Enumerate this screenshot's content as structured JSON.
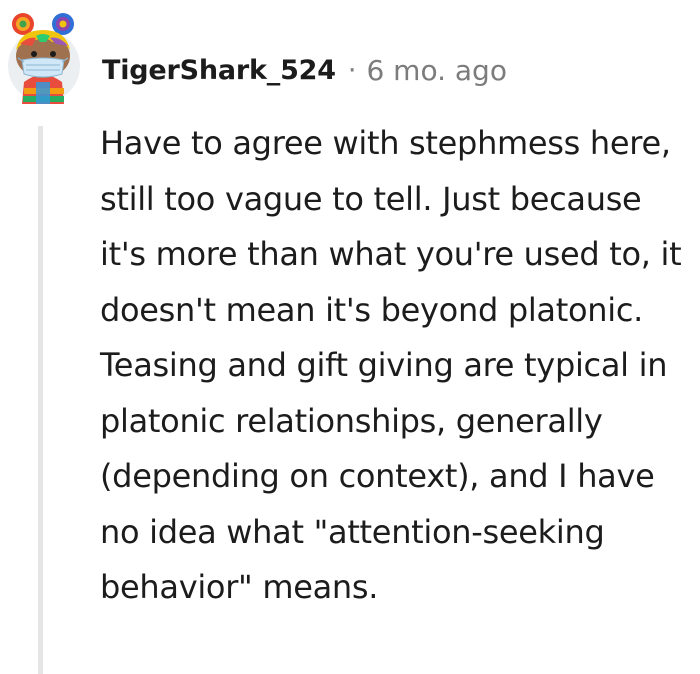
{
  "comment": {
    "username": "TigerShark_524",
    "separator": "·",
    "timestamp": "6 mo. ago",
    "avatar_icon": "reddit-snoo-avatar-icon",
    "body": "Have to agree with stephmess here, still too vague to tell. Just because it's more than what you're used to, it doesn't mean it's beyond platonic. Teasing and gift giving are typical in platonic relationships, generally (depending on context), and I have no idea what \"attention-seeking behavior\" means."
  },
  "colors": {
    "text": "#1c1c1c",
    "meta": "#7c7c7c",
    "thread_line": "#e5e5e5"
  }
}
